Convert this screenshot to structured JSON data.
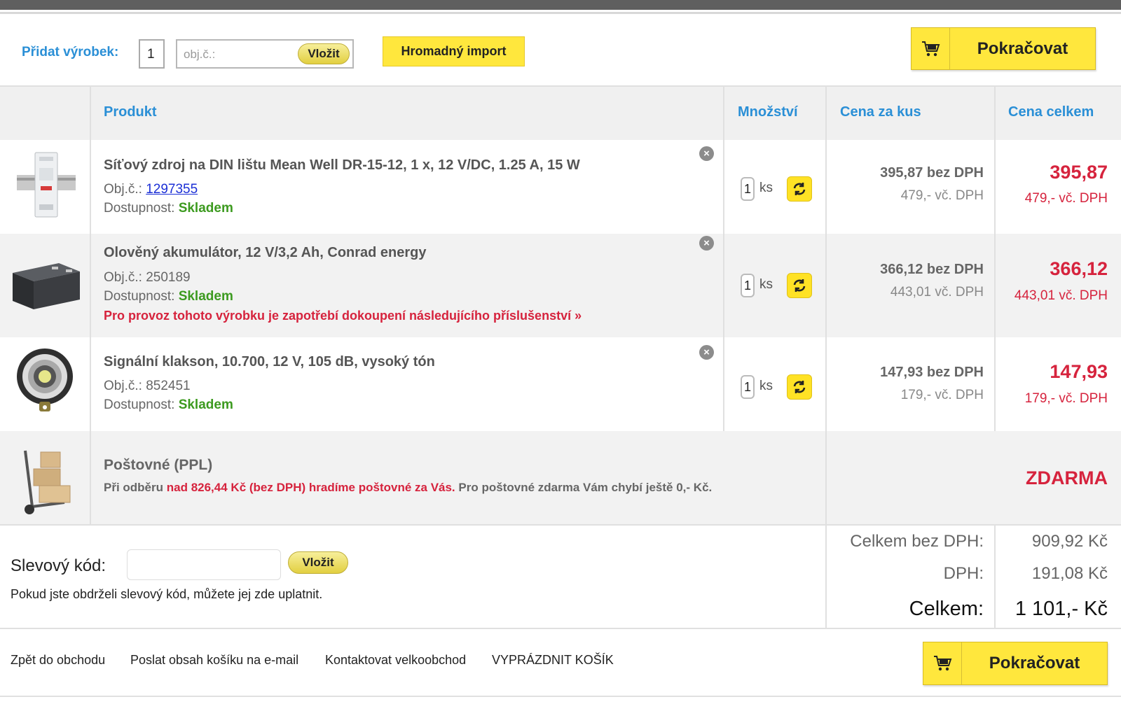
{
  "add_product": {
    "label": "Přidat výrobek:",
    "qty_value": "1",
    "code_placeholder": "obj.č.:",
    "insert_label": "Vložit",
    "bulk_import_label": "Hromadný import"
  },
  "continue_label": "Pokračovat",
  "columns": {
    "product": "Produkt",
    "quantity": "Množství",
    "unit_price": "Cena za kus",
    "total_price": "Cena celkem"
  },
  "products": [
    {
      "name": "Síťový zdroj na DIN lištu Mean Well DR-15-12, 1 x, 12 V/DC, 1.25 A, 15 W",
      "code_label": "Obj.č.:",
      "code": "1297355",
      "availability_label": "Dostupnost:",
      "availability": "Skladem",
      "qty": "1",
      "unit": "ks",
      "unit_net": "395,87 bez DPH",
      "unit_gross": "479,- vč. DPH",
      "total_net": "395,87",
      "total_gross": "479,- vč. DPH",
      "image_icon": "din-power-supply-image"
    },
    {
      "name": "Olověný akumulátor, 12 V/3,2 Ah, Conrad energy",
      "code_label": "Obj.č.:",
      "code": "250189",
      "availability_label": "Dostupnost:",
      "availability": "Skladem",
      "warning": "Pro provoz tohoto výrobku je zapotřebí dokoupení následujícího příslušenství »",
      "qty": "1",
      "unit": "ks",
      "unit_net": "366,12 bez DPH",
      "unit_gross": "443,01 vč. DPH",
      "total_net": "366,12",
      "total_gross": "443,01 vč. DPH",
      "image_icon": "lead-battery-image"
    },
    {
      "name": "Signální klakson, 10.700, 12 V, 105 dB, vysoký tón",
      "code_label": "Obj.č.:",
      "code": "852451",
      "availability_label": "Dostupnost:",
      "availability": "Skladem",
      "qty": "1",
      "unit": "ks",
      "unit_net": "147,93 bez DPH",
      "unit_gross": "179,- vč. DPH",
      "total_net": "147,93",
      "total_gross": "179,- vč. DPH",
      "image_icon": "horn-image"
    }
  ],
  "shipping": {
    "title": "Poštovné (PPL)",
    "note_prefix": "Při odběru",
    "note_highlight": "nad 826,44 Kč (bez DPH) hradíme poštovné za Vás.",
    "note_suffix": "Pro poštovné zdarma Vám chybí ještě 0,- Kč.",
    "price": "ZDARMA",
    "image_icon": "hand-truck-boxes-image"
  },
  "discount": {
    "label": "Slevový kód:",
    "insert_label": "Vložit",
    "hint": "Pokud jste obdrželi slevový kód, můžete jej zde uplatnit."
  },
  "totals": {
    "net_label": "Celkem bez DPH:",
    "net_value": "909,92 Kč",
    "vat_label": "DPH:",
    "vat_value": "191,08 Kč",
    "total_label": "Celkem:",
    "total_value": "1 101,- Kč"
  },
  "footer_links": [
    "Zpět do obchodu",
    "Poslat obsah košíku na e-mail",
    "Kontaktovat velkoobchod",
    "VYPRÁZDNIT KOŠÍK"
  ],
  "colors": {
    "accent_blue": "#2a8fd6",
    "price_red": "#d6233d",
    "stock_green": "#3c9a1f",
    "button_yellow": "#ffe73d"
  }
}
